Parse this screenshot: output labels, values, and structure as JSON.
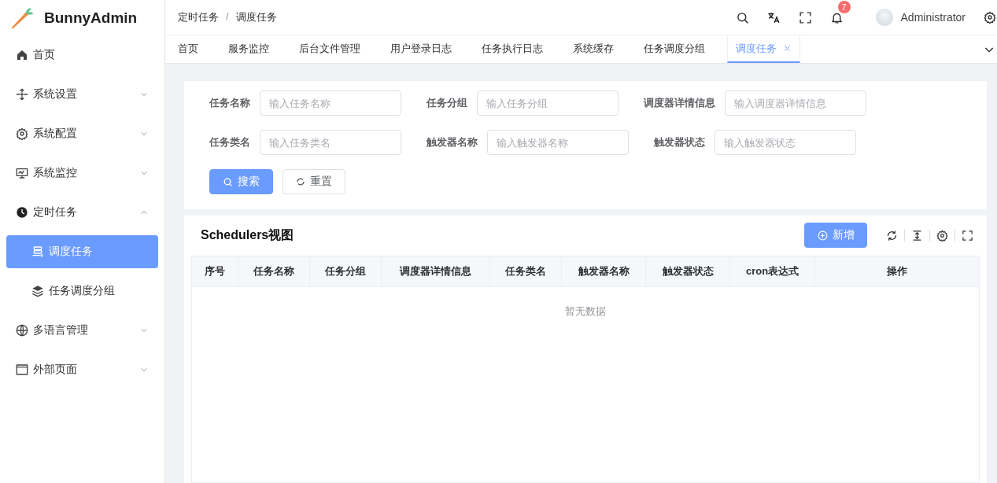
{
  "brand": {
    "name": "BunnyAdmin"
  },
  "sidebar": {
    "items": [
      {
        "label": "首页",
        "selected": false
      },
      {
        "label": "系统设置",
        "selected": false,
        "expanded": false
      },
      {
        "label": "系统配置",
        "selected": false,
        "expanded": false
      },
      {
        "label": "系统监控",
        "selected": false,
        "expanded": false
      },
      {
        "label": "定时任务",
        "selected": false,
        "expanded": true,
        "children": [
          {
            "label": "调度任务",
            "selected": true
          },
          {
            "label": "任务调度分组",
            "selected": false
          }
        ]
      },
      {
        "label": "多语言管理",
        "selected": false,
        "expanded": false
      },
      {
        "label": "外部页面",
        "selected": false,
        "expanded": false
      }
    ]
  },
  "header": {
    "breadcrumb": [
      "定时任务",
      "调度任务"
    ],
    "separator": "/",
    "badge": "7",
    "user": "Administrator"
  },
  "tabs": [
    {
      "label": "首页",
      "selected": false
    },
    {
      "label": "服务监控",
      "selected": false
    },
    {
      "label": "后台文件管理",
      "selected": false
    },
    {
      "label": "用户登录日志",
      "selected": false
    },
    {
      "label": "任务执行日志",
      "selected": false
    },
    {
      "label": "系统缓存",
      "selected": false
    },
    {
      "label": "任务调度分组",
      "selected": false
    },
    {
      "label": "调度任务",
      "selected": true
    }
  ],
  "search_form": {
    "rows": [
      [
        {
          "label": "任务名称",
          "placeholder": "输入任务名称"
        },
        {
          "label": "任务分组",
          "placeholder": "输入任务分组"
        },
        {
          "label": "调度器详情信息",
          "placeholder": "输入调度器详情信息"
        }
      ],
      [
        {
          "label": "任务类名",
          "placeholder": "输入任务类名"
        },
        {
          "label": "触发器名称",
          "placeholder": "输入触发器名称"
        },
        {
          "label": "触发器状态",
          "placeholder": "输入触发器状态"
        }
      ]
    ],
    "buttons": [
      {
        "label": "搜索",
        "kind": "primary"
      },
      {
        "label": "重置",
        "kind": "default"
      }
    ]
  },
  "table_card": {
    "title": "Schedulers视图",
    "add_button": "新增",
    "columns": [
      "序号",
      "任务名称",
      "任务分组",
      "调度器详情信息",
      "任务类名",
      "触发器名称",
      "触发器状态",
      "cron表达式",
      "操作"
    ],
    "empty_text": "暂无数据"
  }
}
